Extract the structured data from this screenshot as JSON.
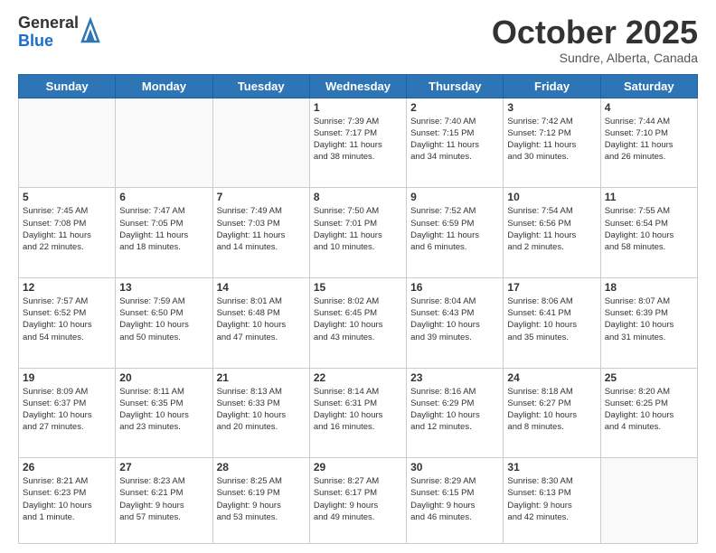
{
  "logo": {
    "general": "General",
    "blue": "Blue"
  },
  "header": {
    "month": "October 2025",
    "location": "Sundre, Alberta, Canada"
  },
  "weekdays": [
    "Sunday",
    "Monday",
    "Tuesday",
    "Wednesday",
    "Thursday",
    "Friday",
    "Saturday"
  ],
  "weeks": [
    [
      {
        "day": "",
        "info": ""
      },
      {
        "day": "",
        "info": ""
      },
      {
        "day": "",
        "info": ""
      },
      {
        "day": "1",
        "info": "Sunrise: 7:39 AM\nSunset: 7:17 PM\nDaylight: 11 hours\nand 38 minutes."
      },
      {
        "day": "2",
        "info": "Sunrise: 7:40 AM\nSunset: 7:15 PM\nDaylight: 11 hours\nand 34 minutes."
      },
      {
        "day": "3",
        "info": "Sunrise: 7:42 AM\nSunset: 7:12 PM\nDaylight: 11 hours\nand 30 minutes."
      },
      {
        "day": "4",
        "info": "Sunrise: 7:44 AM\nSunset: 7:10 PM\nDaylight: 11 hours\nand 26 minutes."
      }
    ],
    [
      {
        "day": "5",
        "info": "Sunrise: 7:45 AM\nSunset: 7:08 PM\nDaylight: 11 hours\nand 22 minutes."
      },
      {
        "day": "6",
        "info": "Sunrise: 7:47 AM\nSunset: 7:05 PM\nDaylight: 11 hours\nand 18 minutes."
      },
      {
        "day": "7",
        "info": "Sunrise: 7:49 AM\nSunset: 7:03 PM\nDaylight: 11 hours\nand 14 minutes."
      },
      {
        "day": "8",
        "info": "Sunrise: 7:50 AM\nSunset: 7:01 PM\nDaylight: 11 hours\nand 10 minutes."
      },
      {
        "day": "9",
        "info": "Sunrise: 7:52 AM\nSunset: 6:59 PM\nDaylight: 11 hours\nand 6 minutes."
      },
      {
        "day": "10",
        "info": "Sunrise: 7:54 AM\nSunset: 6:56 PM\nDaylight: 11 hours\nand 2 minutes."
      },
      {
        "day": "11",
        "info": "Sunrise: 7:55 AM\nSunset: 6:54 PM\nDaylight: 10 hours\nand 58 minutes."
      }
    ],
    [
      {
        "day": "12",
        "info": "Sunrise: 7:57 AM\nSunset: 6:52 PM\nDaylight: 10 hours\nand 54 minutes."
      },
      {
        "day": "13",
        "info": "Sunrise: 7:59 AM\nSunset: 6:50 PM\nDaylight: 10 hours\nand 50 minutes."
      },
      {
        "day": "14",
        "info": "Sunrise: 8:01 AM\nSunset: 6:48 PM\nDaylight: 10 hours\nand 47 minutes."
      },
      {
        "day": "15",
        "info": "Sunrise: 8:02 AM\nSunset: 6:45 PM\nDaylight: 10 hours\nand 43 minutes."
      },
      {
        "day": "16",
        "info": "Sunrise: 8:04 AM\nSunset: 6:43 PM\nDaylight: 10 hours\nand 39 minutes."
      },
      {
        "day": "17",
        "info": "Sunrise: 8:06 AM\nSunset: 6:41 PM\nDaylight: 10 hours\nand 35 minutes."
      },
      {
        "day": "18",
        "info": "Sunrise: 8:07 AM\nSunset: 6:39 PM\nDaylight: 10 hours\nand 31 minutes."
      }
    ],
    [
      {
        "day": "19",
        "info": "Sunrise: 8:09 AM\nSunset: 6:37 PM\nDaylight: 10 hours\nand 27 minutes."
      },
      {
        "day": "20",
        "info": "Sunrise: 8:11 AM\nSunset: 6:35 PM\nDaylight: 10 hours\nand 23 minutes."
      },
      {
        "day": "21",
        "info": "Sunrise: 8:13 AM\nSunset: 6:33 PM\nDaylight: 10 hours\nand 20 minutes."
      },
      {
        "day": "22",
        "info": "Sunrise: 8:14 AM\nSunset: 6:31 PM\nDaylight: 10 hours\nand 16 minutes."
      },
      {
        "day": "23",
        "info": "Sunrise: 8:16 AM\nSunset: 6:29 PM\nDaylight: 10 hours\nand 12 minutes."
      },
      {
        "day": "24",
        "info": "Sunrise: 8:18 AM\nSunset: 6:27 PM\nDaylight: 10 hours\nand 8 minutes."
      },
      {
        "day": "25",
        "info": "Sunrise: 8:20 AM\nSunset: 6:25 PM\nDaylight: 10 hours\nand 4 minutes."
      }
    ],
    [
      {
        "day": "26",
        "info": "Sunrise: 8:21 AM\nSunset: 6:23 PM\nDaylight: 10 hours\nand 1 minute."
      },
      {
        "day": "27",
        "info": "Sunrise: 8:23 AM\nSunset: 6:21 PM\nDaylight: 9 hours\nand 57 minutes."
      },
      {
        "day": "28",
        "info": "Sunrise: 8:25 AM\nSunset: 6:19 PM\nDaylight: 9 hours\nand 53 minutes."
      },
      {
        "day": "29",
        "info": "Sunrise: 8:27 AM\nSunset: 6:17 PM\nDaylight: 9 hours\nand 49 minutes."
      },
      {
        "day": "30",
        "info": "Sunrise: 8:29 AM\nSunset: 6:15 PM\nDaylight: 9 hours\nand 46 minutes."
      },
      {
        "day": "31",
        "info": "Sunrise: 8:30 AM\nSunset: 6:13 PM\nDaylight: 9 hours\nand 42 minutes."
      },
      {
        "day": "",
        "info": ""
      }
    ]
  ]
}
